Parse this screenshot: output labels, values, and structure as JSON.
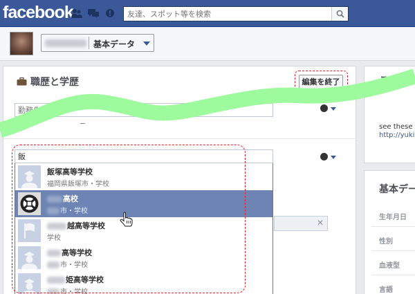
{
  "header": {
    "logo": "facebook",
    "search_placeholder": "友達、スポット等を検索"
  },
  "profile": {
    "basic_data_label": "基本データ"
  },
  "work_education": {
    "title": "職歴と学歴",
    "edit_done_label": "編集を終了",
    "work_placeholder": "勤務先",
    "school_input_value": "飯",
    "partial_text": "ー"
  },
  "suggestions": [
    {
      "name": "飯塚高等学校",
      "sub": "福岡県飯塚市・学校"
    },
    {
      "name": "高校",
      "sub": "市・学校"
    },
    {
      "name": "越高等学校",
      "sub": "学校"
    },
    {
      "name": "高等学校",
      "sub": "市・学校"
    },
    {
      "name": "姫高等学校",
      "sub": "市・学校"
    }
  ],
  "right_panel": {
    "title": "この年は",
    "text": "see these p",
    "link": "http://yuki"
  },
  "basic_panel": {
    "title": "基本デー",
    "fields": [
      "生年月日",
      "性別",
      "血液型",
      "言語"
    ]
  },
  "colors": {
    "facebook_blue": "#3b5998",
    "highlight_row": "#6d84b4",
    "annotation_red": "#e0202a",
    "wave_green": "#9dfa9d"
  }
}
